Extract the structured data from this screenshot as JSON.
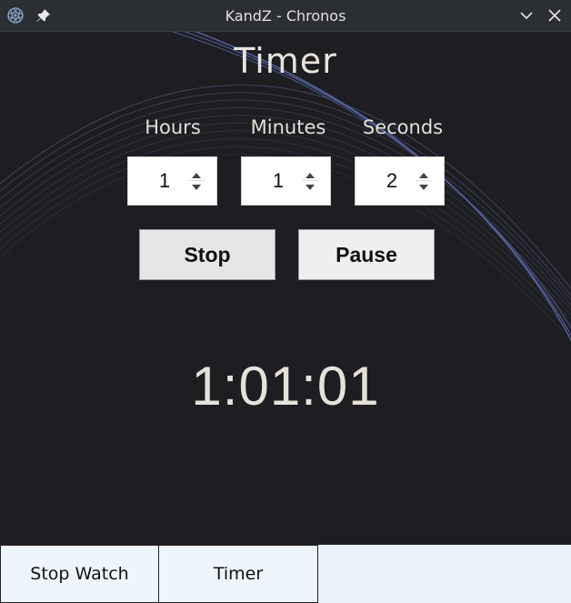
{
  "window": {
    "title": "KandZ - Chronos",
    "app_icon": "gear-atom-icon",
    "pin_icon": "pin-icon",
    "minimize_icon": "chevron-down-icon",
    "close_icon": "close-icon"
  },
  "timer": {
    "heading": "Timer",
    "fields": {
      "hours": {
        "label": "Hours",
        "value": "1"
      },
      "minutes": {
        "label": "Minutes",
        "value": "1"
      },
      "seconds": {
        "label": "Seconds",
        "value": "2"
      }
    },
    "buttons": {
      "stop": "Stop",
      "pause": "Pause"
    },
    "countdown": "1:01:01"
  },
  "tabs": [
    {
      "label": "Stop Watch"
    },
    {
      "label": "Timer"
    }
  ],
  "colors": {
    "background": "#1e1d22",
    "titlebar": "#2b2e33",
    "text": "#e6e2da",
    "arc_accent": "#4a5a9a",
    "tab_background": "#eaf3fb"
  }
}
